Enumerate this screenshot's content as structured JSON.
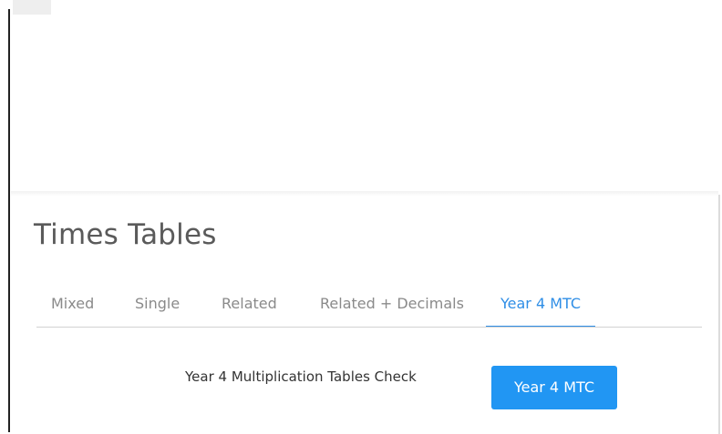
{
  "header": {
    "title": "Times Tables"
  },
  "tabs": [
    {
      "label": "Mixed",
      "active": false
    },
    {
      "label": "Single",
      "active": false
    },
    {
      "label": "Related",
      "active": false
    },
    {
      "label": "Related + Decimals",
      "active": false
    },
    {
      "label": "Year 4 MTC",
      "active": true
    }
  ],
  "content": {
    "check_label": "Year 4 Multiplication Tables Check",
    "button_label": "Year 4 MTC"
  },
  "colors": {
    "accent": "#2196f3",
    "active_tab": "#2f8ee6",
    "tab_text": "#8a8a8a",
    "title_text": "#5a5a5a"
  }
}
